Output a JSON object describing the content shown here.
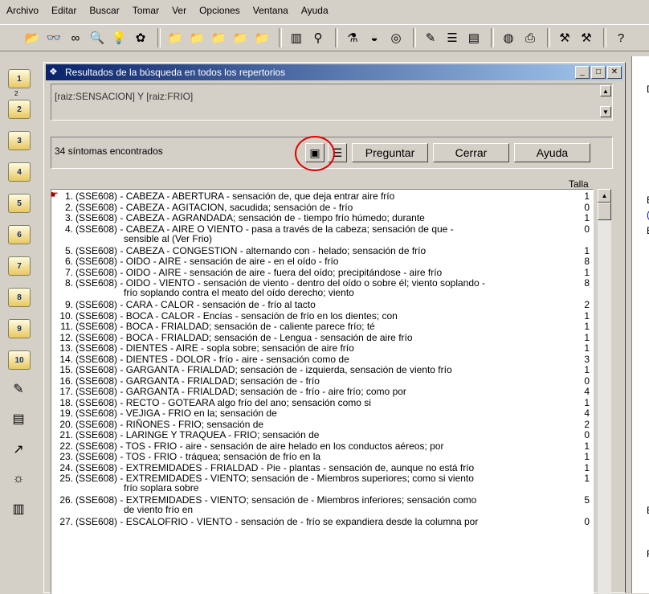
{
  "menu": [
    "Archivo",
    "Editar",
    "Buscar",
    "Tomar",
    "Ver",
    "Opciones",
    "Ventana",
    "Ayuda"
  ],
  "toolbar_icons": [
    "open-icon",
    "binoculars-icon",
    "glasses-icon",
    "magnifier-icon",
    "bulb-icon",
    "herb-icon",
    "folder-icon",
    "folder2-icon",
    "folder3-icon",
    "folder4-icon",
    "folder5-icon",
    "chart-icon",
    "tree-icon",
    "flask-icon",
    "hat-icon",
    "target-icon",
    "notes-icon",
    "list-icon",
    "book-icon",
    "globe-icon",
    "printer-icon",
    "tool-icon",
    "tool2-icon",
    "help-icon"
  ],
  "sidebar": {
    "items": [
      "1",
      "2",
      "3",
      "4",
      "5",
      "6",
      "7",
      "8",
      "9",
      "10"
    ],
    "sub_label": "2"
  },
  "window": {
    "title": "Resultados de la búsqueda en todos los repertorios",
    "query": "[raiz:SENSACION] Y [raiz:FRIO]",
    "result_count": "34 síntomas encontrados",
    "buttons": {
      "preguntar": "Preguntar",
      "cerrar": "Cerrar",
      "ayuda": "Ayuda"
    },
    "talla_header": "Talla"
  },
  "results": [
    {
      "n": "1.",
      "text": "(SSE608) - CABEZA - ABERTURA - sensación de, que deja entrar aire frío",
      "talla": "1"
    },
    {
      "n": "2.",
      "text": "(SSE608) - CABEZA - AGITACION, sacudida; sensación de - frío",
      "talla": "0"
    },
    {
      "n": "3.",
      "text": "(SSE608) - CABEZA - AGRANDADA; sensación de - tiempo frío húmedo; durante",
      "talla": "1"
    },
    {
      "n": "4.",
      "text": "(SSE608) - CABEZA - AIRE O VIENTO - pasa a través de la cabeza; sensación de que -",
      "text2": "sensible al (Ver Frio)",
      "talla": "0"
    },
    {
      "n": "5.",
      "text": "(SSE608) - CABEZA - CONGESTION - alternando con - helado; sensación de frío",
      "talla": "1"
    },
    {
      "n": "6.",
      "text": "(SSE608) - OIDO - AIRE - sensación de aire - en el oído - frío",
      "talla": "8"
    },
    {
      "n": "7.",
      "text": "(SSE608) - OIDO - AIRE - sensación de aire - fuera del oído; precipitándose - aire frío",
      "talla": "1"
    },
    {
      "n": "8.",
      "text": "(SSE608) - OIDO - VIENTO - sensación de viento - dentro del oído o sobre él; viento soplando -",
      "text2": "frío soplando contra el meato del oído derecho; viento",
      "talla": "8"
    },
    {
      "n": "9.",
      "text": "(SSE608) - CARA - CALOR - sensación de - frío al tacto",
      "talla": "2"
    },
    {
      "n": "10.",
      "text": "(SSE608) - BOCA - CALOR - Encías - sensación de frío en los dientes; con",
      "talla": "1"
    },
    {
      "n": "11.",
      "text": "(SSE608) - BOCA - FRIALDAD; sensación de - caliente parece frío; té",
      "talla": "1"
    },
    {
      "n": "12.",
      "text": "(SSE608) - BOCA - FRIALDAD; sensación de - Lengua - sensación de aire frío",
      "talla": "1"
    },
    {
      "n": "13.",
      "text": "(SSE608) - DIENTES - AIRE - sopla sobre; sensación de aire frío",
      "talla": "1"
    },
    {
      "n": "14.",
      "text": "(SSE608) - DIENTES - DOLOR - frío - aire - sensación como de",
      "talla": "3"
    },
    {
      "n": "15.",
      "text": "(SSE608) - GARGANTA - FRIALDAD; sensación de - izquierda, sensación de viento frío",
      "talla": "1"
    },
    {
      "n": "16.",
      "text": "(SSE608) - GARGANTA - FRIALDAD; sensación de - frío",
      "talla": "0"
    },
    {
      "n": "17.",
      "text": "(SSE608) - GARGANTA - FRIALDAD; sensación de - frío - aire frío; como por",
      "talla": "4"
    },
    {
      "n": "18.",
      "text": "(SSE608) - RECTO - GOTEARA algo frío del ano; sensación como si",
      "talla": "1"
    },
    {
      "n": "19.",
      "text": "(SSE608) - VEJIGA - FRIO en la; sensación de",
      "talla": "4"
    },
    {
      "n": "20.",
      "text": "(SSE608) - RIÑONES - FRIO; sensación de",
      "talla": "2"
    },
    {
      "n": "21.",
      "text": "(SSE608) - LARINGE Y TRAQUEA - FRIO; sensación de",
      "talla": "0"
    },
    {
      "n": "22.",
      "text": "(SSE608) - TOS - FRIO - aire - sensación de aire helado en los conductos aéreos; por",
      "talla": "1"
    },
    {
      "n": "23.",
      "text": "(SSE608) - TOS - FRIO - tráquea; sensación de frío en la",
      "talla": "1"
    },
    {
      "n": "24.",
      "text": "(SSE608) - EXTREMIDADES - FRIALDAD - Pie - plantas - sensación de, aunque no está frío",
      "talla": "1"
    },
    {
      "n": "25.",
      "text": "(SSE608) - EXTREMIDADES - VIENTO; sensación de - Miembros superiores; como si viento",
      "text2": "frío soplara sobre",
      "talla": "1"
    },
    {
      "n": "26.",
      "text": "(SSE608) - EXTREMIDADES - VIENTO; sensación de - Miembros inferiores; sensación como",
      "text2": "de viento frío en",
      "talla": "5"
    },
    {
      "n": "27.",
      "text": "(SSE608) - ESCALOFRIO - VIENTO - sensación de - frío se expandiera desde la columna por",
      "talla": "0"
    }
  ],
  "right_pane_letters": [
    "D",
    "E",
    "(",
    "E",
    "E",
    "F"
  ]
}
